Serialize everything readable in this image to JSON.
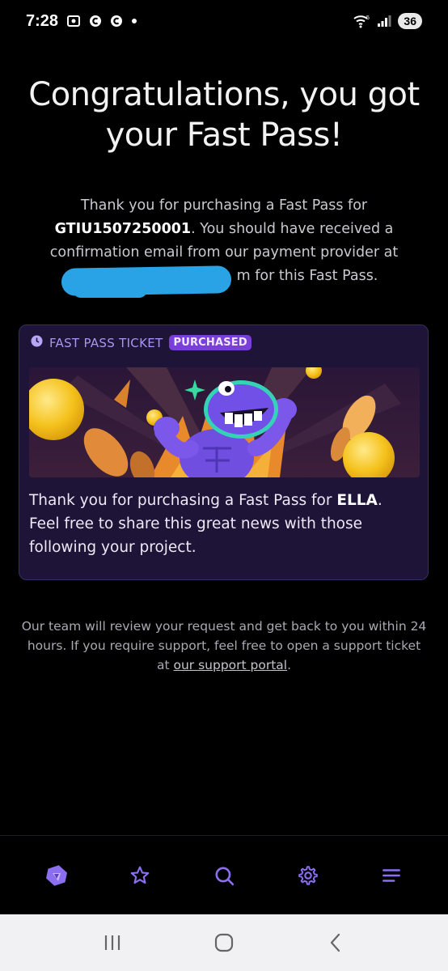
{
  "status_bar": {
    "time": "7:28",
    "battery": "36",
    "icons": [
      "screenshot-icon",
      "c-app-icon",
      "c-app-icon",
      "dot-icon",
      "wifi-icon",
      "signal-icon"
    ]
  },
  "title": "Congratulations, you got your Fast Pass!",
  "intro": {
    "part1": "Thank you for purchasing a Fast Pass for ",
    "ticket_id": "GTIU1507250001",
    "part2": ". You should have received a confirmation email from our payment provider at ",
    "email_visible_suffix": "m",
    "part3": " for this Fast Pass."
  },
  "card": {
    "label": "FAST PASS TICKET",
    "badge": "PURCHASED",
    "text_part1": "Thank you for purchasing a Fast Pass for ",
    "project": "ELLA",
    "text_part2": ". Feel free to share this great news with those following your project."
  },
  "footer_note": {
    "text": "Our team will review your request and get back to you within 24 hours. If you require support, feel free to open a support ticket at ",
    "link": "our support portal",
    "end": "."
  },
  "bottom_nav": {
    "items": [
      "home-logo-icon",
      "star-icon",
      "search-icon",
      "gear-icon",
      "menu-icon"
    ]
  },
  "colors": {
    "accent": "#7a3fd9",
    "card_bg": "#1e1438",
    "nav_icon": "#8b6ff0",
    "redaction": "#2aa3e6"
  }
}
